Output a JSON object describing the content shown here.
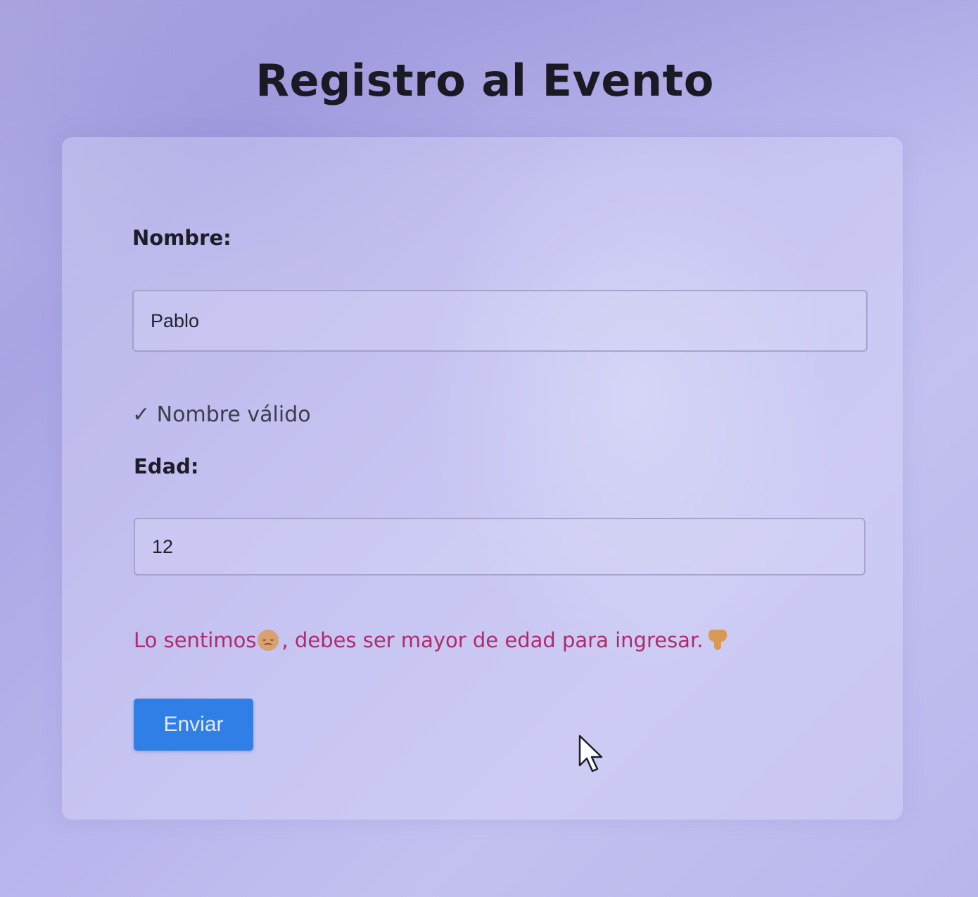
{
  "page": {
    "title": "Registro al Evento"
  },
  "form": {
    "name_label": "Nombre:",
    "name_value": "Pablo",
    "name_status": "✓ Nombre válido",
    "age_label": "Edad:",
    "age_value": "12",
    "error_before_icon": "Lo sentimos",
    "error_after_icon": ", debes ser mayor de edad para ingresar.",
    "error_icons": [
      "disappointed-face-icon",
      "thumbs-down-icon"
    ],
    "submit_label": "Enviar"
  },
  "colors": {
    "button": "#2f7fe6",
    "error_text": "#b02a6e",
    "valid_text": "#3c3d4f"
  }
}
